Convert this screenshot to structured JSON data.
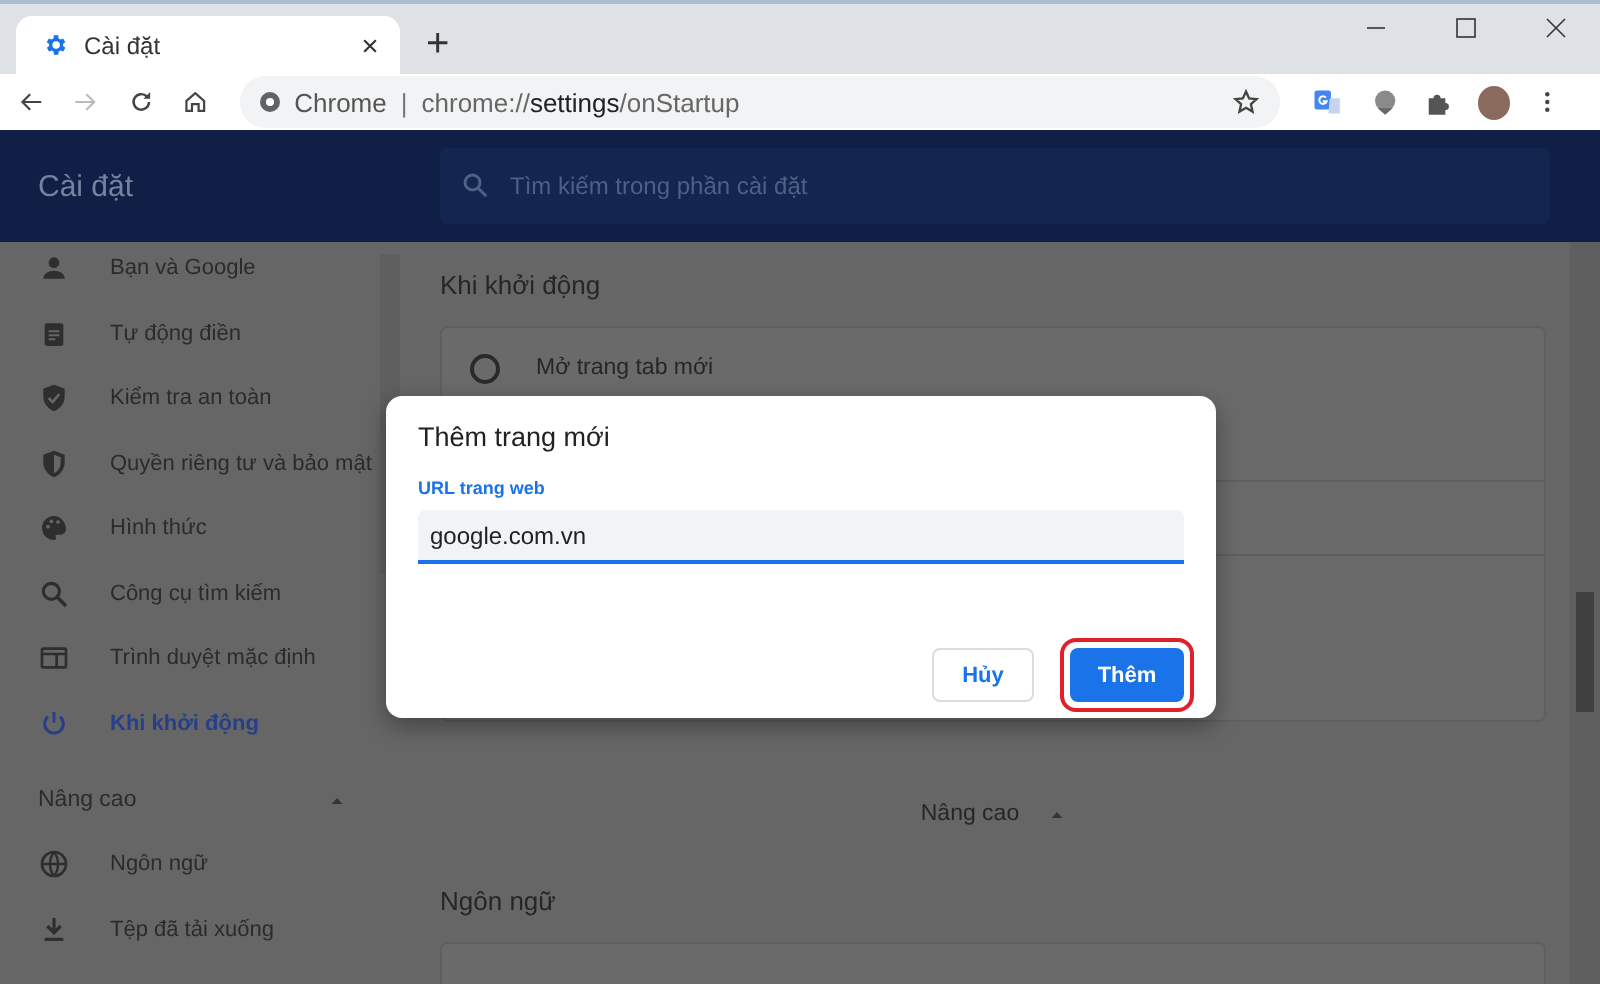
{
  "browser": {
    "tab": {
      "title": "Cài đặt"
    },
    "new_tab": "+",
    "omnibox": {
      "site_label": "Chrome",
      "separator": "|",
      "url": "chrome://**settings**/onStartup"
    }
  },
  "header": {
    "title": "Cài đặt",
    "search": {
      "placeholder": "Tìm kiếm trong phần cài đặt"
    }
  },
  "sidebar": {
    "items": [
      {
        "label": "Bạn và Google",
        "selected": false
      },
      {
        "label": "Tự động điền",
        "selected": false
      },
      {
        "label": "Kiểm tra an toàn",
        "selected": false
      },
      {
        "label": "Quyền riêng tư và bảo mật",
        "selected": false
      },
      {
        "label": "Hình thức",
        "selected": false
      },
      {
        "label": "Công cụ tìm kiếm",
        "selected": false
      },
      {
        "label": "Trình duyệt mặc định",
        "selected": false
      },
      {
        "label": "Khi khởi động",
        "selected": true
      }
    ],
    "advanced": {
      "label": "Nâng cao",
      "expanded": true,
      "items": [
        {
          "label": "Ngôn ngữ",
          "selected": false
        },
        {
          "label": "Tệp đã tải xuống",
          "selected": false
        }
      ]
    }
  },
  "main": {
    "section": {
      "title": "Khi khởi động",
      "options": [
        {
          "label": "Mở trang tab mới",
          "selected": false
        }
      ]
    },
    "advanced_toggle": {
      "label": "Nâng cao",
      "expanded": true
    },
    "next_section": {
      "title": "Ngôn ngữ"
    }
  },
  "dialog": {
    "title": "Thêm trang mới",
    "field": {
      "label": "URL trang web",
      "value": "google.com.vn",
      "focused": true
    },
    "buttons": [
      {
        "label": "Hủy",
        "kind": "secondary",
        "highlighted": false
      },
      {
        "label": "Thêm",
        "kind": "primary",
        "highlighted": true
      }
    ]
  }
}
